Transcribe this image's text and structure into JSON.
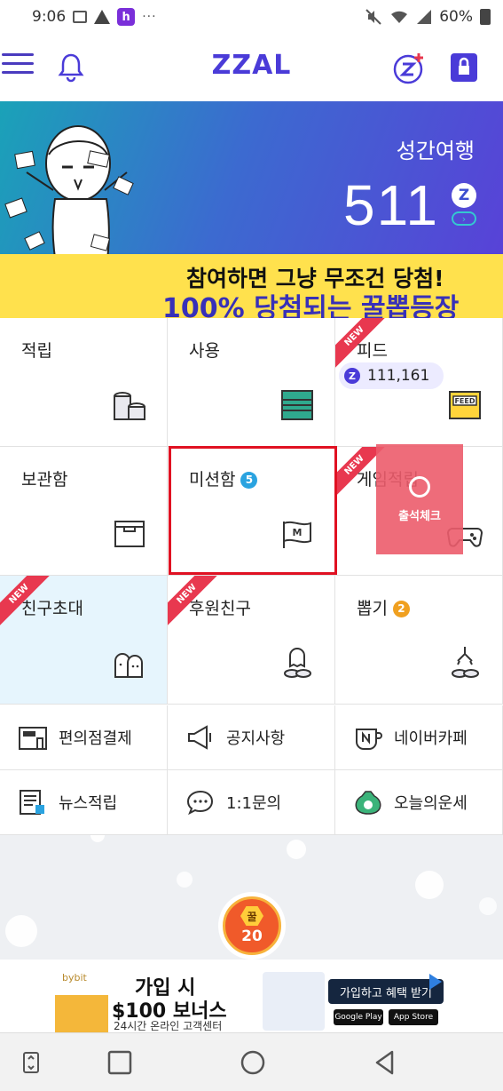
{
  "status": {
    "time": "9:06",
    "battery": "60%",
    "notif_h": "h",
    "more": "···"
  },
  "header": {
    "logo": "ZZAL"
  },
  "banner": {
    "title": "성간여행",
    "count": "511",
    "z": "Z",
    "arrow": "›",
    "line1": "참여하면 그냥 무조건 당첨!",
    "line2": "100% 당첨되는 꿀뽑등장"
  },
  "grid": {
    "earn": "적립",
    "use": "사용",
    "feed": "피드",
    "feed_count": "111,161",
    "storage": "보관함",
    "mission": "미션함",
    "mission_badge": "5",
    "game": "게임적립",
    "invite": "친구초대",
    "sponsor": "후원친구",
    "draw": "뽑기",
    "draw_badge": "2",
    "new_label": "NEW",
    "z": "Z",
    "feed_tag": "FEED",
    "flag_m": "M"
  },
  "checkin": {
    "label": "출석체크"
  },
  "menu": {
    "store_pay": "편의점결제",
    "notice": "공지사항",
    "naver_cafe": "네이버카페",
    "news": "뉴스적립",
    "inquiry": "1:1문의",
    "fortune": "오늘의운세"
  },
  "coin": {
    "label": "꿀",
    "count": "20"
  },
  "ad": {
    "brand": "bybit",
    "line1": "가입 시",
    "line2": "$100 보너스",
    "line3": "24시간 온라인 고객센터",
    "cta": "가입하고 혜택 받기",
    "google": "Google Play",
    "apple": "App Store"
  },
  "colors": {
    "brand": "#4a3bd8",
    "highlight": "#e01122",
    "checkin": "#ec5c6c",
    "coin": "#f05a2a"
  }
}
